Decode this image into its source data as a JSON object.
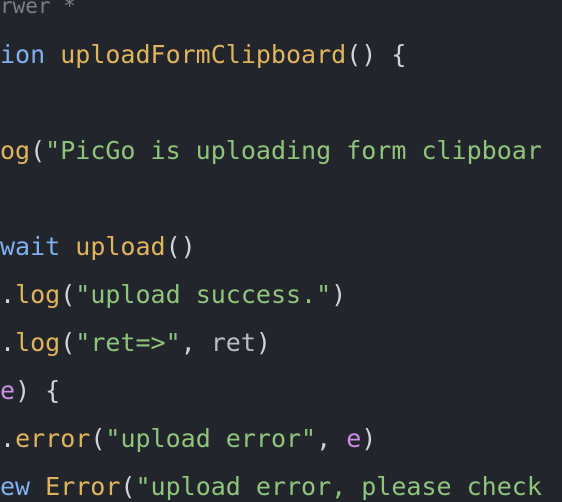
{
  "tab": {
    "label": "rwer *"
  },
  "code": {
    "lines": [
      [
        {
          "text": "ion ",
          "cls": "t-kw"
        },
        {
          "text": "uploadFormClipboard",
          "cls": "t-fn"
        },
        {
          "text": "() {",
          "cls": "t-punct"
        }
      ],
      [],
      [
        {
          "text": "og",
          "cls": "t-fn"
        },
        {
          "text": "(",
          "cls": "t-punct"
        },
        {
          "text": "\"PicGo is uploading form clipboar",
          "cls": "t-str"
        }
      ],
      [],
      [
        {
          "text": "wait ",
          "cls": "t-kw"
        },
        {
          "text": "upload",
          "cls": "t-fn"
        },
        {
          "text": "()",
          "cls": "t-punct"
        }
      ],
      [
        {
          "text": ".",
          "cls": "t-punct"
        },
        {
          "text": "log",
          "cls": "t-fn"
        },
        {
          "text": "(",
          "cls": "t-punct"
        },
        {
          "text": "\"upload success.\"",
          "cls": "t-str"
        },
        {
          "text": ")",
          "cls": "t-punct"
        }
      ],
      [
        {
          "text": ".",
          "cls": "t-punct"
        },
        {
          "text": "log",
          "cls": "t-fn"
        },
        {
          "text": "(",
          "cls": "t-punct"
        },
        {
          "text": "\"ret=>\"",
          "cls": "t-str"
        },
        {
          "text": ", ",
          "cls": "t-punct"
        },
        {
          "text": "ret",
          "cls": "t-var"
        },
        {
          "text": ")",
          "cls": "t-punct"
        }
      ],
      [
        {
          "text": "e",
          "cls": "t-param"
        },
        {
          "text": ") {",
          "cls": "t-punct"
        }
      ],
      [
        {
          "text": ".",
          "cls": "t-punct"
        },
        {
          "text": "error",
          "cls": "t-fn"
        },
        {
          "text": "(",
          "cls": "t-punct"
        },
        {
          "text": "\"upload error\"",
          "cls": "t-str"
        },
        {
          "text": ", ",
          "cls": "t-punct"
        },
        {
          "text": "e",
          "cls": "t-param"
        },
        {
          "text": ")",
          "cls": "t-punct"
        }
      ],
      [
        {
          "text": "ew ",
          "cls": "t-kw"
        },
        {
          "text": "Error",
          "cls": "t-fn"
        },
        {
          "text": "(",
          "cls": "t-punct"
        },
        {
          "text": "\"upload error, please check",
          "cls": "t-str"
        }
      ]
    ]
  },
  "colors": {
    "background": "#22252c",
    "keyword": "#7fb0f0",
    "function": "#e0b45c",
    "string": "#8fc47b",
    "variable": "#b7bcc6",
    "param": "#c98fe3",
    "punct": "#cfd3da"
  }
}
